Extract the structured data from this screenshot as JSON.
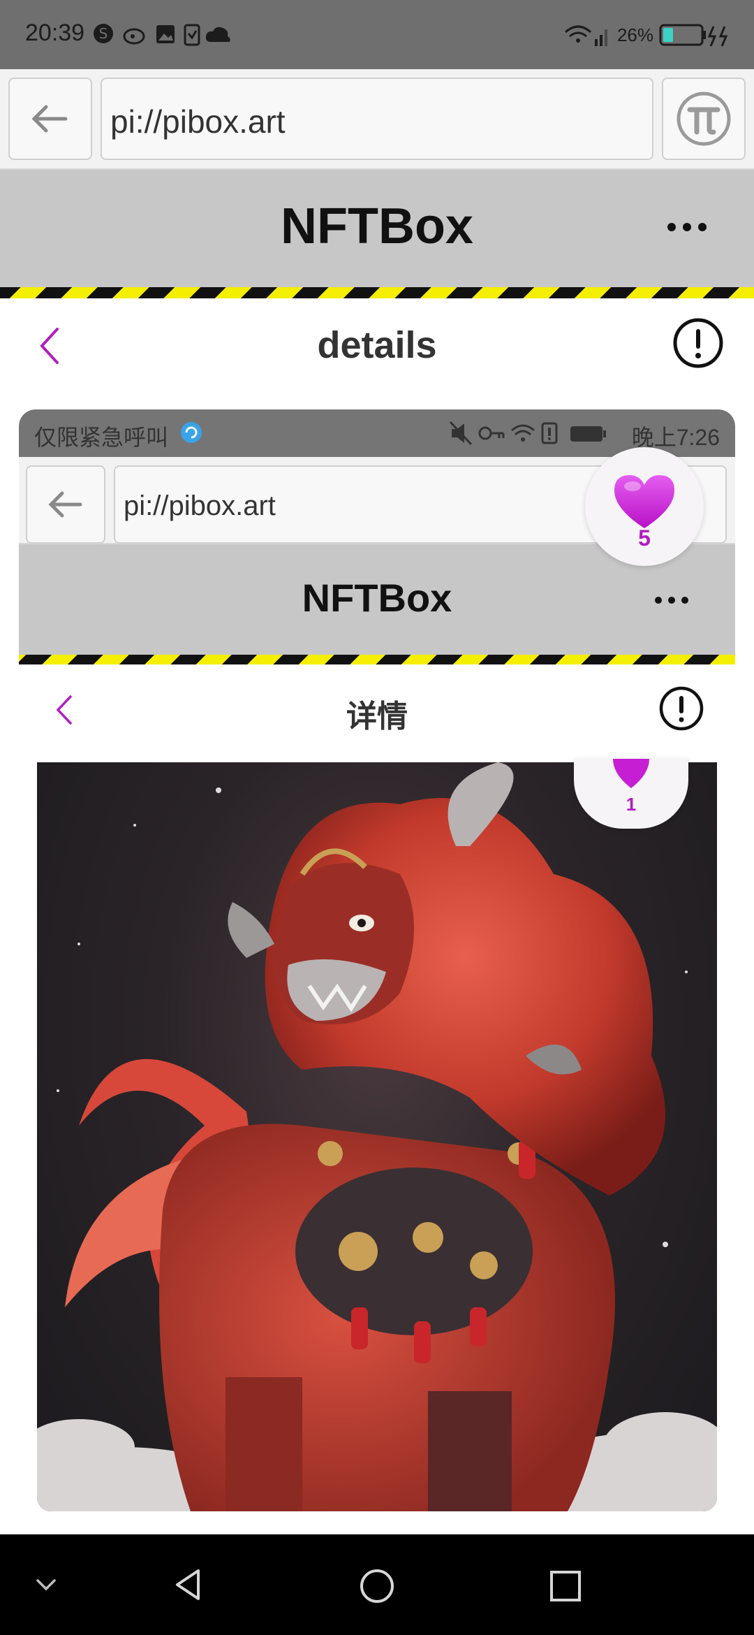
{
  "status_bar": {
    "time": "20:39",
    "battery_percent": "26%",
    "icons": [
      "s-badge-icon",
      "weibo-icon",
      "image-icon",
      "clipboard-icon",
      "cloud-icon",
      "wifi-icon",
      "signal-icon",
      "battery-icon",
      "charging-icon"
    ]
  },
  "browser": {
    "url": "pi://pibox.art",
    "back_icon": "arrow-left-icon",
    "pi_icon": "pi-logo-icon"
  },
  "app_header": {
    "title": "NFTBox",
    "more_icon": "more-horizontal-icon"
  },
  "details_header": {
    "title": "details",
    "back_icon": "chevron-left-icon",
    "info_icon": "exclamation-circle-icon"
  },
  "embedded_screenshot": {
    "status_left": "仅限紧急呼叫",
    "status_time": "晚上7:26",
    "url": "pi://pibox.art",
    "app_title": "NFTBox",
    "details_title": "详情",
    "like_count": "1"
  },
  "like_badge": {
    "count": "5",
    "icon": "heart-icon"
  },
  "colors": {
    "accent": "#b01ec0",
    "heart": "#c61fd3",
    "header_bg": "#c7c7c7",
    "hazard_yellow": "#f4ee00",
    "hazard_black": "#111111",
    "status_bg": "#6f6f6f"
  },
  "nav_bar": {
    "icons": [
      "chevron-down-icon",
      "back-triangle-icon",
      "home-circle-icon",
      "recents-square-icon"
    ]
  }
}
